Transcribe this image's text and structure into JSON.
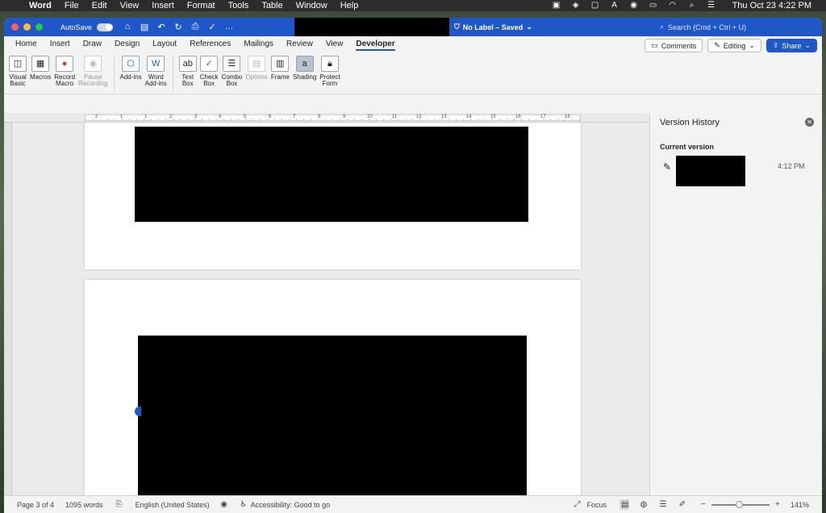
{
  "menubar": {
    "app": "Word",
    "items": [
      "File",
      "Edit",
      "View",
      "Insert",
      "Format",
      "Tools",
      "Table",
      "Window",
      "Help"
    ],
    "datetime": "Thu Oct 23  4:22 PM"
  },
  "titlebar": {
    "autosave_label": "AutoSave",
    "doc_status": "No Label – Saved",
    "search_placeholder": "Search (Cmd + Ctrl + U)"
  },
  "ribbon": {
    "tabs": [
      "Home",
      "Insert",
      "Draw",
      "Design",
      "Layout",
      "References",
      "Mailings",
      "Review",
      "View",
      "Developer"
    ],
    "active_tab": "Developer",
    "comments_label": "Comments",
    "editing_label": "Editing",
    "share_label": "Share",
    "tools": {
      "visual_basic": [
        "Visual",
        "Basic"
      ],
      "macros": [
        "Macros"
      ],
      "record_macro": [
        "Record",
        "Macro"
      ],
      "pause_recording": [
        "Pause",
        "Recording"
      ],
      "add_ins": [
        "Add-ins"
      ],
      "word_add_ins": [
        "Word",
        "Add-ins"
      ],
      "text_box": [
        "Text",
        "Box"
      ],
      "check_box": [
        "Check",
        "Box"
      ],
      "combo_box": [
        "Combo",
        "Box"
      ],
      "options": [
        "Options"
      ],
      "frame": [
        "Frame"
      ],
      "shading": [
        "Shading"
      ],
      "protect_form": [
        "Protect",
        "Form"
      ]
    }
  },
  "ruler": {
    "numbers": [
      "2",
      "1",
      "1",
      "2",
      "3",
      "4",
      "5",
      "6",
      "7",
      "8",
      "9",
      "10",
      "11",
      "12",
      "13",
      "14",
      "15",
      "16",
      "17",
      "18"
    ]
  },
  "version_history": {
    "title": "Version History",
    "current_label": "Current version",
    "time": "4:12 PM"
  },
  "status": {
    "page": "Page 3 of 4",
    "words": "1095 words",
    "language": "English (United States)",
    "accessibility": "Accessibility: Good to go",
    "focus": "Focus",
    "zoom": "141%",
    "zoom_fraction": 0.47
  }
}
